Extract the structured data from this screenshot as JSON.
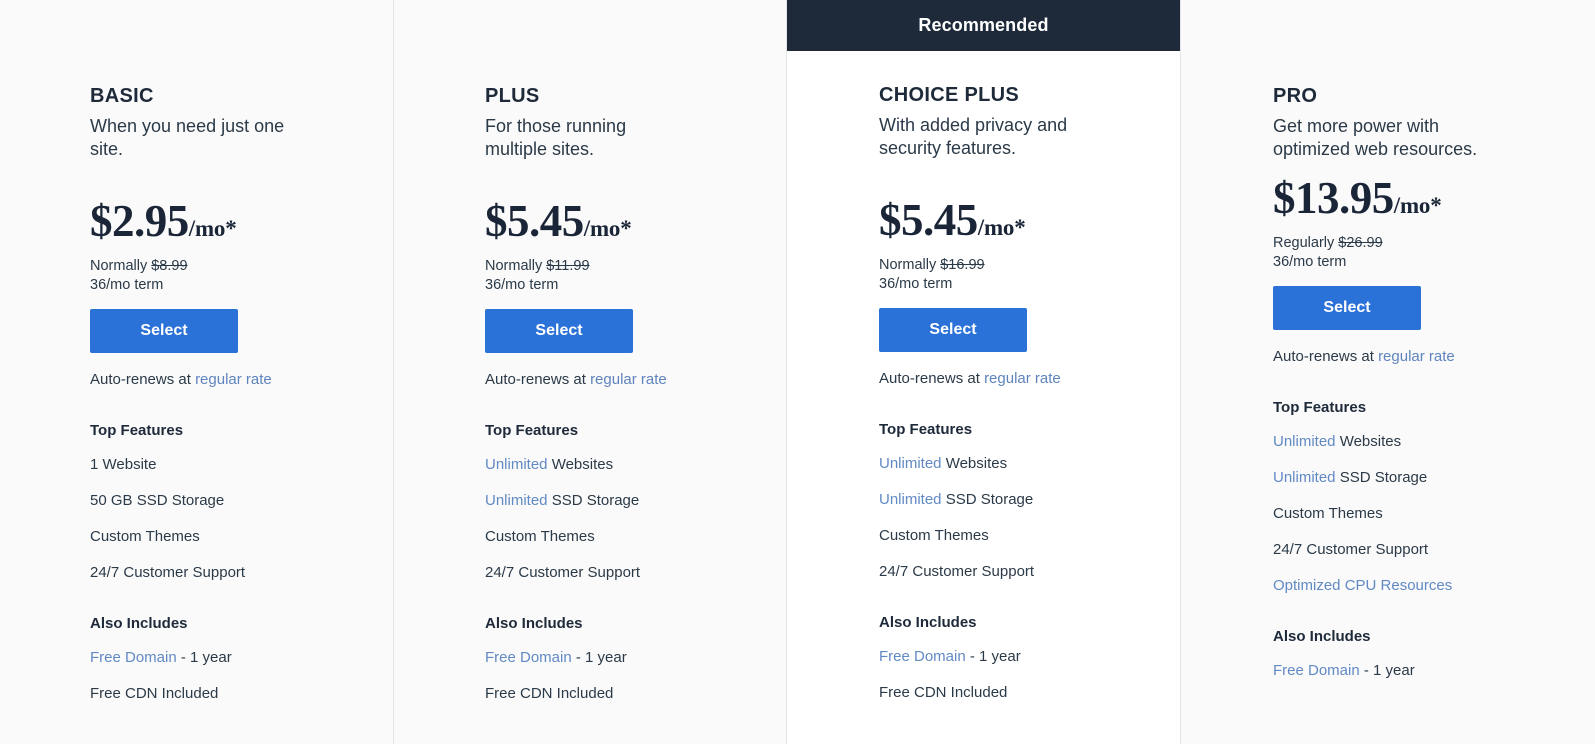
{
  "theme": {
    "page_bg": "#fafafa",
    "highlight_card_bg": "#ffffff",
    "banner_bg": "#1e2a3a",
    "button_bg": "#2a71d8",
    "link_color": "#5f84bd",
    "heading_color": "#1e2a3a",
    "divider_color": "#e3e5e8"
  },
  "badges": {
    "recommended": "Recommended"
  },
  "labels": {
    "top_features": "Top Features",
    "also_includes": "Also Includes",
    "select": "Select",
    "auto_renews_prefix": "Auto-renews at",
    "regular_rate_link": "regular rate",
    "term": "36/mo term"
  },
  "plans": [
    {
      "id": "basic",
      "name": "BASIC",
      "tagline": "When you need just one site.",
      "price": "$2.95",
      "price_suffix": "/mo*",
      "normally_label": "Normally",
      "normally_price": "$8.99",
      "term": "36/mo term",
      "select_label": "Select",
      "auto_renews_prefix": "Auto-renews at",
      "auto_renews_link": "regular rate",
      "recommended": false,
      "top_features_label": "Top Features",
      "top_features": [
        {
          "highlight": "",
          "text": "1 Website"
        },
        {
          "highlight": "",
          "text": "50 GB SSD Storage"
        },
        {
          "highlight": "",
          "text": "Custom Themes"
        },
        {
          "highlight": "",
          "text": "24/7 Customer Support"
        }
      ],
      "also_includes_label": "Also Includes",
      "also_includes": [
        {
          "highlight": "Free Domain",
          "text": " - 1 year"
        },
        {
          "highlight": "",
          "text": "Free CDN Included"
        }
      ]
    },
    {
      "id": "plus",
      "name": "PLUS",
      "tagline": "For those running multiple sites.",
      "price": "$5.45",
      "price_suffix": "/mo*",
      "normally_label": "Normally",
      "normally_price": "$11.99",
      "term": "36/mo term",
      "select_label": "Select",
      "auto_renews_prefix": "Auto-renews at",
      "auto_renews_link": "regular rate",
      "recommended": false,
      "top_features_label": "Top Features",
      "top_features": [
        {
          "highlight": "Unlimited",
          "text": " Websites"
        },
        {
          "highlight": "Unlimited",
          "text": " SSD Storage"
        },
        {
          "highlight": "",
          "text": "Custom Themes"
        },
        {
          "highlight": "",
          "text": "24/7 Customer Support"
        }
      ],
      "also_includes_label": "Also Includes",
      "also_includes": [
        {
          "highlight": "Free Domain",
          "text": " - 1 year"
        },
        {
          "highlight": "",
          "text": "Free CDN Included"
        }
      ]
    },
    {
      "id": "choice-plus",
      "name": "CHOICE PLUS",
      "tagline": "With added privacy and security features.",
      "price": "$5.45",
      "price_suffix": "/mo*",
      "normally_label": "Normally",
      "normally_price": "$16.99",
      "term": "36/mo term",
      "select_label": "Select",
      "auto_renews_prefix": "Auto-renews at",
      "auto_renews_link": "regular rate",
      "recommended": true,
      "recommended_label": "Recommended",
      "top_features_label": "Top Features",
      "top_features": [
        {
          "highlight": "Unlimited",
          "text": " Websites"
        },
        {
          "highlight": "Unlimited",
          "text": " SSD Storage"
        },
        {
          "highlight": "",
          "text": "Custom Themes"
        },
        {
          "highlight": "",
          "text": "24/7 Customer Support"
        }
      ],
      "also_includes_label": "Also Includes",
      "also_includes": [
        {
          "highlight": "Free Domain",
          "text": " - 1 year"
        },
        {
          "highlight": "",
          "text": "Free CDN Included"
        }
      ]
    },
    {
      "id": "pro",
      "name": "PRO",
      "tagline": "Get more power with optimized web resources.",
      "price": "$13.95",
      "price_suffix": "/mo*",
      "normally_label": "Regularly",
      "normally_price": "$26.99",
      "term": "36/mo term",
      "select_label": "Select",
      "auto_renews_prefix": "Auto-renews at",
      "auto_renews_link": "regular rate",
      "recommended": false,
      "top_features_label": "Top Features",
      "top_features": [
        {
          "highlight": "Unlimited",
          "text": " Websites"
        },
        {
          "highlight": "Unlimited",
          "text": " SSD Storage"
        },
        {
          "highlight": "",
          "text": "Custom Themes"
        },
        {
          "highlight": "",
          "text": "24/7 Customer Support"
        },
        {
          "highlight": "Optimized CPU Resources",
          "text": ""
        }
      ],
      "also_includes_label": "Also Includes",
      "also_includes": [
        {
          "highlight": "Free Domain",
          "text": " - 1 year"
        }
      ]
    }
  ]
}
